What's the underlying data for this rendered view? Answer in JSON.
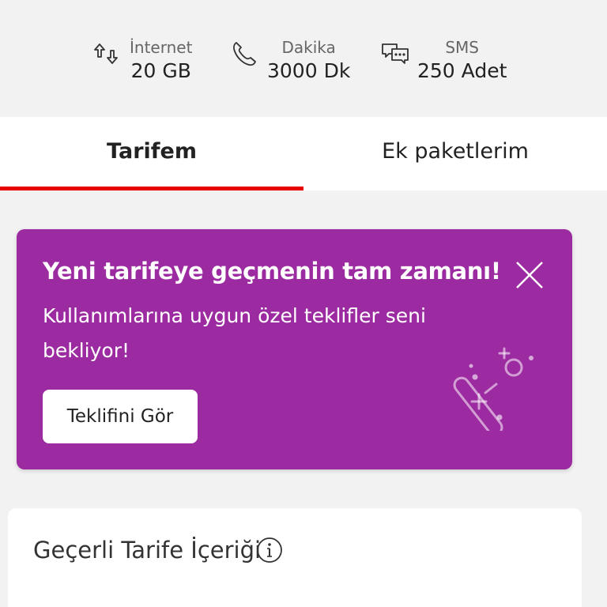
{
  "usage": [
    {
      "icon": "data-transfer-icon",
      "label": "İnternet",
      "value": "20 GB"
    },
    {
      "icon": "phone-icon",
      "label": "Dakika",
      "value": "3000 Dk"
    },
    {
      "icon": "chat-icon",
      "label": "SMS",
      "value": "250 Adet"
    }
  ],
  "tabs": {
    "tariff": "Tarifem",
    "extra_packages": "Ek paketlerim",
    "active": "tariff"
  },
  "promo": {
    "title": "Yeni tarifeye geçmenin tam zamanı!",
    "text": "Kullanımlarına uygun özel teklifler seni bekliyor!",
    "button": "Teklifini Gör",
    "bg_color": "#9c2aa0",
    "illustration": "magic-wand-icon"
  },
  "tariff_card": {
    "title": "Geçerli Tarife İçeriği",
    "info_icon": "info-icon"
  },
  "colors": {
    "accent": "#e60000",
    "background": "#f2f2f2"
  }
}
